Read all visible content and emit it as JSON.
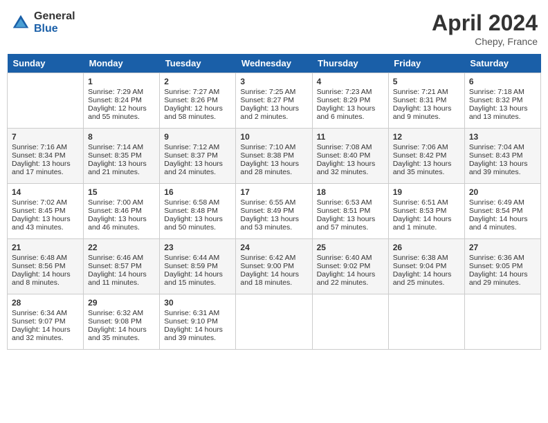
{
  "header": {
    "logo_general": "General",
    "logo_blue": "Blue",
    "month_year": "April 2024",
    "location": "Chepy, France"
  },
  "days_of_week": [
    "Sunday",
    "Monday",
    "Tuesday",
    "Wednesday",
    "Thursday",
    "Friday",
    "Saturday"
  ],
  "weeks": [
    [
      {
        "day": "",
        "sunrise": "",
        "sunset": "",
        "daylight": ""
      },
      {
        "day": "1",
        "sunrise": "Sunrise: 7:29 AM",
        "sunset": "Sunset: 8:24 PM",
        "daylight": "Daylight: 12 hours and 55 minutes."
      },
      {
        "day": "2",
        "sunrise": "Sunrise: 7:27 AM",
        "sunset": "Sunset: 8:26 PM",
        "daylight": "Daylight: 12 hours and 58 minutes."
      },
      {
        "day": "3",
        "sunrise": "Sunrise: 7:25 AM",
        "sunset": "Sunset: 8:27 PM",
        "daylight": "Daylight: 13 hours and 2 minutes."
      },
      {
        "day": "4",
        "sunrise": "Sunrise: 7:23 AM",
        "sunset": "Sunset: 8:29 PM",
        "daylight": "Daylight: 13 hours and 6 minutes."
      },
      {
        "day": "5",
        "sunrise": "Sunrise: 7:21 AM",
        "sunset": "Sunset: 8:31 PM",
        "daylight": "Daylight: 13 hours and 9 minutes."
      },
      {
        "day": "6",
        "sunrise": "Sunrise: 7:18 AM",
        "sunset": "Sunset: 8:32 PM",
        "daylight": "Daylight: 13 hours and 13 minutes."
      }
    ],
    [
      {
        "day": "7",
        "sunrise": "Sunrise: 7:16 AM",
        "sunset": "Sunset: 8:34 PM",
        "daylight": "Daylight: 13 hours and 17 minutes."
      },
      {
        "day": "8",
        "sunrise": "Sunrise: 7:14 AM",
        "sunset": "Sunset: 8:35 PM",
        "daylight": "Daylight: 13 hours and 21 minutes."
      },
      {
        "day": "9",
        "sunrise": "Sunrise: 7:12 AM",
        "sunset": "Sunset: 8:37 PM",
        "daylight": "Daylight: 13 hours and 24 minutes."
      },
      {
        "day": "10",
        "sunrise": "Sunrise: 7:10 AM",
        "sunset": "Sunset: 8:38 PM",
        "daylight": "Daylight: 13 hours and 28 minutes."
      },
      {
        "day": "11",
        "sunrise": "Sunrise: 7:08 AM",
        "sunset": "Sunset: 8:40 PM",
        "daylight": "Daylight: 13 hours and 32 minutes."
      },
      {
        "day": "12",
        "sunrise": "Sunrise: 7:06 AM",
        "sunset": "Sunset: 8:42 PM",
        "daylight": "Daylight: 13 hours and 35 minutes."
      },
      {
        "day": "13",
        "sunrise": "Sunrise: 7:04 AM",
        "sunset": "Sunset: 8:43 PM",
        "daylight": "Daylight: 13 hours and 39 minutes."
      }
    ],
    [
      {
        "day": "14",
        "sunrise": "Sunrise: 7:02 AM",
        "sunset": "Sunset: 8:45 PM",
        "daylight": "Daylight: 13 hours and 43 minutes."
      },
      {
        "day": "15",
        "sunrise": "Sunrise: 7:00 AM",
        "sunset": "Sunset: 8:46 PM",
        "daylight": "Daylight: 13 hours and 46 minutes."
      },
      {
        "day": "16",
        "sunrise": "Sunrise: 6:58 AM",
        "sunset": "Sunset: 8:48 PM",
        "daylight": "Daylight: 13 hours and 50 minutes."
      },
      {
        "day": "17",
        "sunrise": "Sunrise: 6:55 AM",
        "sunset": "Sunset: 8:49 PM",
        "daylight": "Daylight: 13 hours and 53 minutes."
      },
      {
        "day": "18",
        "sunrise": "Sunrise: 6:53 AM",
        "sunset": "Sunset: 8:51 PM",
        "daylight": "Daylight: 13 hours and 57 minutes."
      },
      {
        "day": "19",
        "sunrise": "Sunrise: 6:51 AM",
        "sunset": "Sunset: 8:53 PM",
        "daylight": "Daylight: 14 hours and 1 minute."
      },
      {
        "day": "20",
        "sunrise": "Sunrise: 6:49 AM",
        "sunset": "Sunset: 8:54 PM",
        "daylight": "Daylight: 14 hours and 4 minutes."
      }
    ],
    [
      {
        "day": "21",
        "sunrise": "Sunrise: 6:48 AM",
        "sunset": "Sunset: 8:56 PM",
        "daylight": "Daylight: 14 hours and 8 minutes."
      },
      {
        "day": "22",
        "sunrise": "Sunrise: 6:46 AM",
        "sunset": "Sunset: 8:57 PM",
        "daylight": "Daylight: 14 hours and 11 minutes."
      },
      {
        "day": "23",
        "sunrise": "Sunrise: 6:44 AM",
        "sunset": "Sunset: 8:59 PM",
        "daylight": "Daylight: 14 hours and 15 minutes."
      },
      {
        "day": "24",
        "sunrise": "Sunrise: 6:42 AM",
        "sunset": "Sunset: 9:00 PM",
        "daylight": "Daylight: 14 hours and 18 minutes."
      },
      {
        "day": "25",
        "sunrise": "Sunrise: 6:40 AM",
        "sunset": "Sunset: 9:02 PM",
        "daylight": "Daylight: 14 hours and 22 minutes."
      },
      {
        "day": "26",
        "sunrise": "Sunrise: 6:38 AM",
        "sunset": "Sunset: 9:04 PM",
        "daylight": "Daylight: 14 hours and 25 minutes."
      },
      {
        "day": "27",
        "sunrise": "Sunrise: 6:36 AM",
        "sunset": "Sunset: 9:05 PM",
        "daylight": "Daylight: 14 hours and 29 minutes."
      }
    ],
    [
      {
        "day": "28",
        "sunrise": "Sunrise: 6:34 AM",
        "sunset": "Sunset: 9:07 PM",
        "daylight": "Daylight: 14 hours and 32 minutes."
      },
      {
        "day": "29",
        "sunrise": "Sunrise: 6:32 AM",
        "sunset": "Sunset: 9:08 PM",
        "daylight": "Daylight: 14 hours and 35 minutes."
      },
      {
        "day": "30",
        "sunrise": "Sunrise: 6:31 AM",
        "sunset": "Sunset: 9:10 PM",
        "daylight": "Daylight: 14 hours and 39 minutes."
      },
      {
        "day": "",
        "sunrise": "",
        "sunset": "",
        "daylight": ""
      },
      {
        "day": "",
        "sunrise": "",
        "sunset": "",
        "daylight": ""
      },
      {
        "day": "",
        "sunrise": "",
        "sunset": "",
        "daylight": ""
      },
      {
        "day": "",
        "sunrise": "",
        "sunset": "",
        "daylight": ""
      }
    ]
  ]
}
